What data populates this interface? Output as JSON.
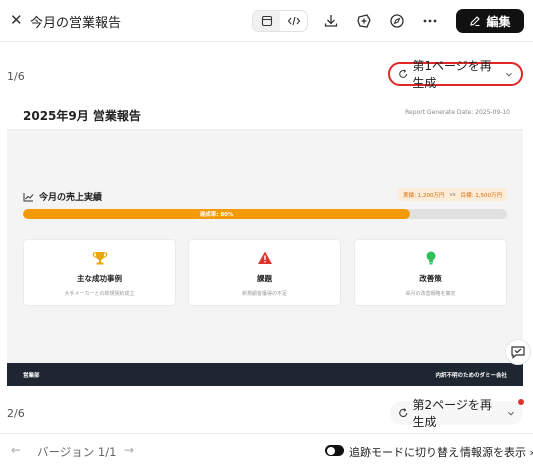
{
  "header": {
    "close_glyph": "✕",
    "title": "今月の営業報告",
    "edit_label": "編集",
    "icons": [
      "close-icon",
      "preview-icon",
      "code-icon",
      "download-icon",
      "share-icon",
      "compass-icon",
      "more-icon",
      "edit-pencil-icon"
    ]
  },
  "pages": [
    {
      "index_label": "1/6",
      "regen_label": "第1ページを再生成"
    },
    {
      "index_label": "2/6",
      "regen_label": "第2ページを再生成"
    }
  ],
  "report": {
    "title": "2025年9月 営業報告",
    "date": "Report Generate Date: 2025-09-10",
    "sales_heading": "今月の売上実績",
    "actual": "実績: 1,200万円",
    "vs": "vs",
    "target": "目標: 1,500万円",
    "progress_label": "達成率: 80%",
    "progress_value": 0.8,
    "cards": [
      {
        "icon": "trophy-icon",
        "title": "主な成功事例",
        "subtitle": "大手メーカーとの新規契約成立",
        "color": "#e8a70d"
      },
      {
        "icon": "warning-icon",
        "title": "課題",
        "subtitle": "新規顧客獲得の不足",
        "color": "#e0332b"
      },
      {
        "icon": "lightbulb-icon",
        "title": "改善策",
        "subtitle": "来月の改善戦略を策定",
        "color": "#2fbf5b"
      }
    ],
    "footer_left": "営業部",
    "footer_right": "内訳不明のためのダミー会社"
  },
  "bottom": {
    "prev_glyph": "←",
    "next_glyph": "→",
    "version_label": "バージョン 1/1",
    "track_mode_label": "追跡モードに切り替え",
    "track_mode_on": true,
    "source_label": "情報源を表示 ›"
  },
  "colors": {
    "accent_orange": "#f39a08",
    "highlight_red": "#e02727",
    "footer_dark": "#1d2631"
  }
}
